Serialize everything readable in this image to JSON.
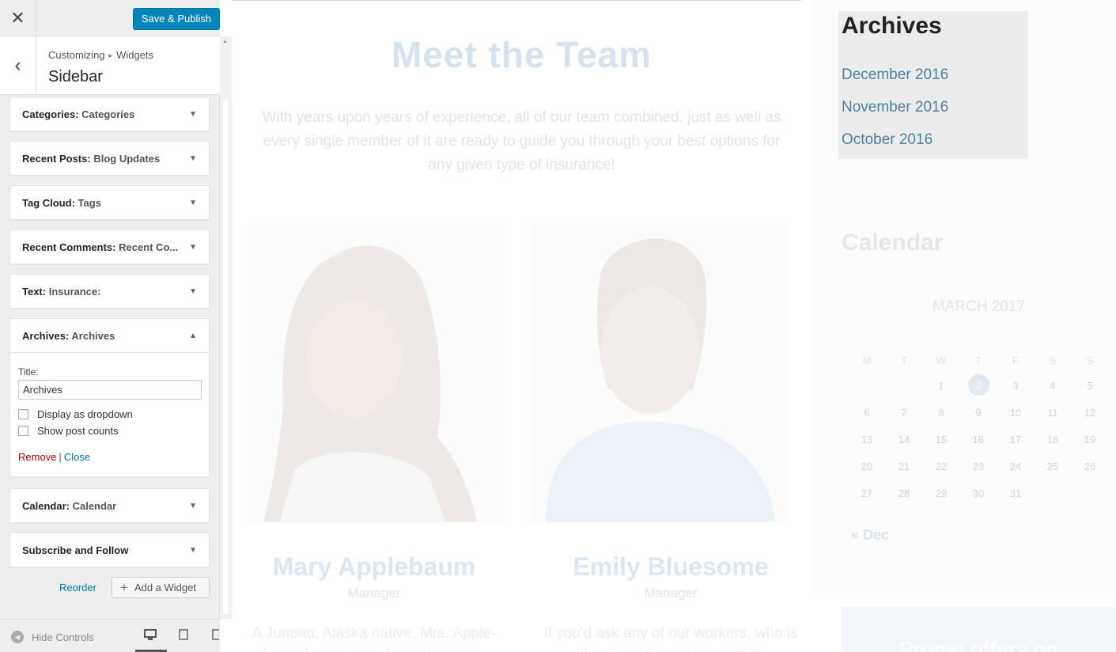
{
  "header": {
    "close_label": "✕",
    "save_label": "Save & Publish"
  },
  "section": {
    "back_label": "‹",
    "breadcrumb": [
      "Customizing",
      "Widgets"
    ],
    "breadcrumb_sep": "▸",
    "title": "Sidebar"
  },
  "widgets": [
    {
      "type": "Categories",
      "name": "Categories"
    },
    {
      "type": "Recent Posts",
      "name": "Blog Updates"
    },
    {
      "type": "Tag Cloud",
      "name": "Tags"
    },
    {
      "type": "Recent Comments",
      "name": "Recent Co..."
    },
    {
      "type": "Text",
      "name": "Insurance:"
    },
    {
      "type": "Archives",
      "name": "Archives"
    },
    {
      "type": "Calendar",
      "name": "Calendar"
    },
    {
      "type": "Subscribe and Follow",
      "name": ""
    }
  ],
  "archives_form": {
    "title_label": "Title:",
    "title_value": "Archives",
    "dropdown_label": "Display as dropdown",
    "counts_label": "Show post counts",
    "remove_label": "Remove",
    "separator": "|",
    "close_label": "Close"
  },
  "panel_actions": {
    "reorder_label": "Reorder",
    "add_widget_label": "Add a Widget",
    "add_icon": "+"
  },
  "footer": {
    "hide_controls_label": "Hide Controls"
  },
  "preview": {
    "team_title": "Meet the Team",
    "team_desc": "With years upon years of experience, all of our team combined, just as well as every single member of it are ready to guide you through your best options for any given type of insurance!",
    "members": [
      {
        "name": "Mary Applebaum",
        "role": "Manager",
        "bio": "A Juneau, Alaska native, Mrs. Apple-baum has come a long way since"
      },
      {
        "name": "Emily Bluesome",
        "role": "Manager",
        "bio": "If you'd ask any of our workers, who is the executive manager that"
      }
    ],
    "archives": {
      "title": "Archives",
      "links": [
        "December 2016",
        "November 2016",
        "October 2016"
      ]
    },
    "calendar": {
      "title": "Calendar",
      "month": "MARCH 2017",
      "weekdays": [
        "M",
        "T",
        "W",
        "T",
        "F",
        "S",
        "S"
      ],
      "weeks": [
        [
          "",
          "",
          "1",
          "2",
          "3",
          "4",
          "5"
        ],
        [
          "6",
          "7",
          "8",
          "9",
          "10",
          "11",
          "12"
        ],
        [
          "13",
          "14",
          "15",
          "16",
          "17",
          "18",
          "19"
        ],
        [
          "20",
          "21",
          "22",
          "23",
          "24",
          "25",
          "26"
        ],
        [
          "27",
          "28",
          "29",
          "30",
          "31",
          "",
          ""
        ]
      ],
      "today": "2",
      "prev_label": "« Dec"
    },
    "promo_text": "Promo offers on"
  },
  "colors": {
    "accent": "#0085ba",
    "link": "#0073aa",
    "remove": "#aa0000",
    "archive_link": "#4f7f9e"
  }
}
